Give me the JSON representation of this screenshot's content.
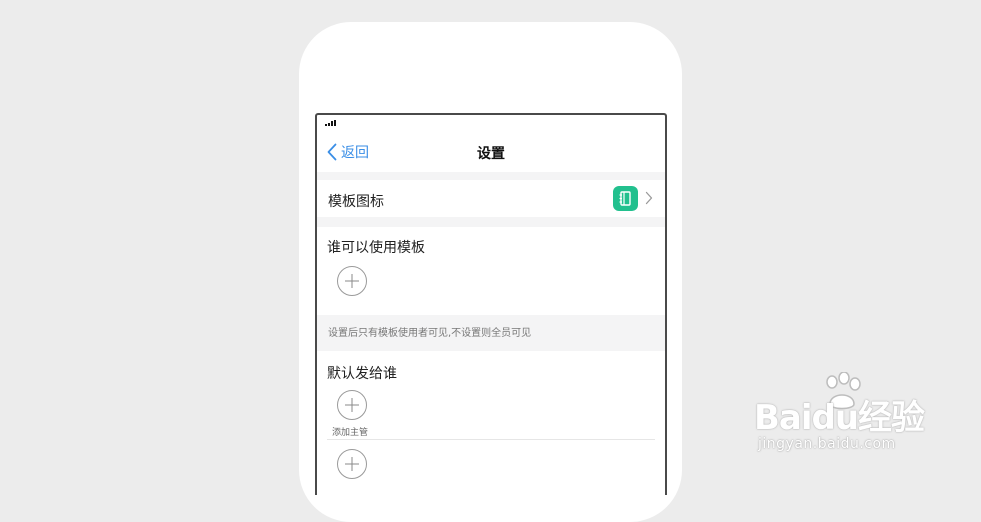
{
  "nav": {
    "back_label": "返回",
    "title": "设置"
  },
  "template_icon_row": {
    "label": "模板图标",
    "icon": "notebook-icon",
    "icon_color": "#22c08e"
  },
  "who_can_use": {
    "label": "谁可以使用模板",
    "hint": "设置后只有模板使用者可见,不设置则全员可见"
  },
  "default_send": {
    "label": "默认发给谁",
    "first_add_label": "添加主管"
  },
  "colors": {
    "accent": "#3a8ee6",
    "page_bg": "#ececec",
    "gap_bg": "#f4f4f5"
  },
  "watermark": {
    "brand": "Baidu经验",
    "url": "jingyan.baidu.com"
  }
}
